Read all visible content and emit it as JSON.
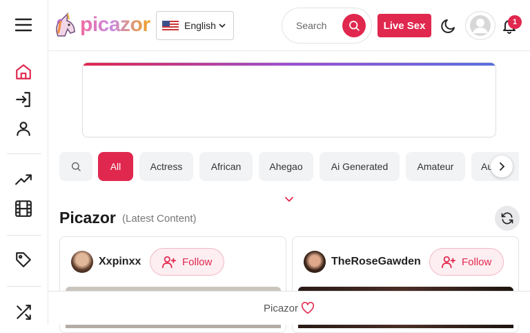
{
  "sidebar": {
    "icons": [
      "menu-icon",
      "home-icon",
      "login-icon",
      "user-icon",
      "trending-icon",
      "film-icon",
      "tag-icon",
      "shuffle-icon"
    ]
  },
  "header": {
    "logo_text": "picazor",
    "language": "English",
    "search_label": "Search",
    "live_button": "Live Sex",
    "notification_count": "1"
  },
  "categories": {
    "items": [
      "All",
      "Actress",
      "African",
      "Ahegao",
      "Ai Generated",
      "Amateur",
      "Au E"
    ],
    "active": "All"
  },
  "section": {
    "title": "Picazor",
    "subtitle": "(Latest Content)"
  },
  "cards": [
    {
      "username": "Xxpinxx",
      "follow_label": "Follow"
    },
    {
      "username": "TheRoseGawden",
      "follow_label": "Follow"
    }
  ],
  "footer": {
    "text": "Picazor"
  },
  "colors": {
    "accent": "#e0284f"
  }
}
